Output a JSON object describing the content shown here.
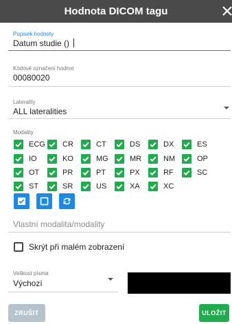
{
  "dialog": {
    "title": "Hodnota DICOM tagu",
    "close_icon": "close-icon"
  },
  "fields": {
    "value_label": {
      "label": "Popisek hodnoty",
      "value": "Datum studie ()"
    },
    "value_code": {
      "label": "Kódové označení hodnot",
      "value": "00080020"
    },
    "laterality": {
      "label": "Laterality",
      "value": "ALL lateralities"
    }
  },
  "modalities": {
    "label": "Modality",
    "items": [
      {
        "name": "ECG",
        "checked": true
      },
      {
        "name": "CR",
        "checked": true
      },
      {
        "name": "CT",
        "checked": true
      },
      {
        "name": "DS",
        "checked": true
      },
      {
        "name": "DX",
        "checked": true
      },
      {
        "name": "ES",
        "checked": true
      },
      {
        "name": "IO",
        "checked": true
      },
      {
        "name": "KO",
        "checked": true
      },
      {
        "name": "MG",
        "checked": true
      },
      {
        "name": "MR",
        "checked": true
      },
      {
        "name": "NM",
        "checked": true
      },
      {
        "name": "OP",
        "checked": true
      },
      {
        "name": "OT",
        "checked": true
      },
      {
        "name": "PR",
        "checked": true
      },
      {
        "name": "PT",
        "checked": true
      },
      {
        "name": "PX",
        "checked": true
      },
      {
        "name": "RF",
        "checked": true
      },
      {
        "name": "SC",
        "checked": true
      },
      {
        "name": "ST",
        "checked": true
      },
      {
        "name": "SR",
        "checked": true
      },
      {
        "name": "US",
        "checked": true
      },
      {
        "name": "XA",
        "checked": true
      },
      {
        "name": "XC",
        "checked": true
      }
    ],
    "action_icons": [
      "check-all-icon",
      "uncheck-all-icon",
      "reset-icon"
    ]
  },
  "custom_modality": {
    "placeholder": "Vlastní modalita/modality"
  },
  "hide_small": {
    "label": "Skrýt při malém zobrazení",
    "checked": false
  },
  "font_size": {
    "label": "Velikost písma",
    "value": "Výchozí"
  },
  "buttons": {
    "cancel": "ZRUŠIT",
    "save": "ULOŽIT"
  },
  "colors": {
    "titlebar": "#4a4a4a",
    "accent_blue": "#1e88e5",
    "checkbox_green": "#22aa4e",
    "cancel_disabled": "#b6c3cc"
  }
}
